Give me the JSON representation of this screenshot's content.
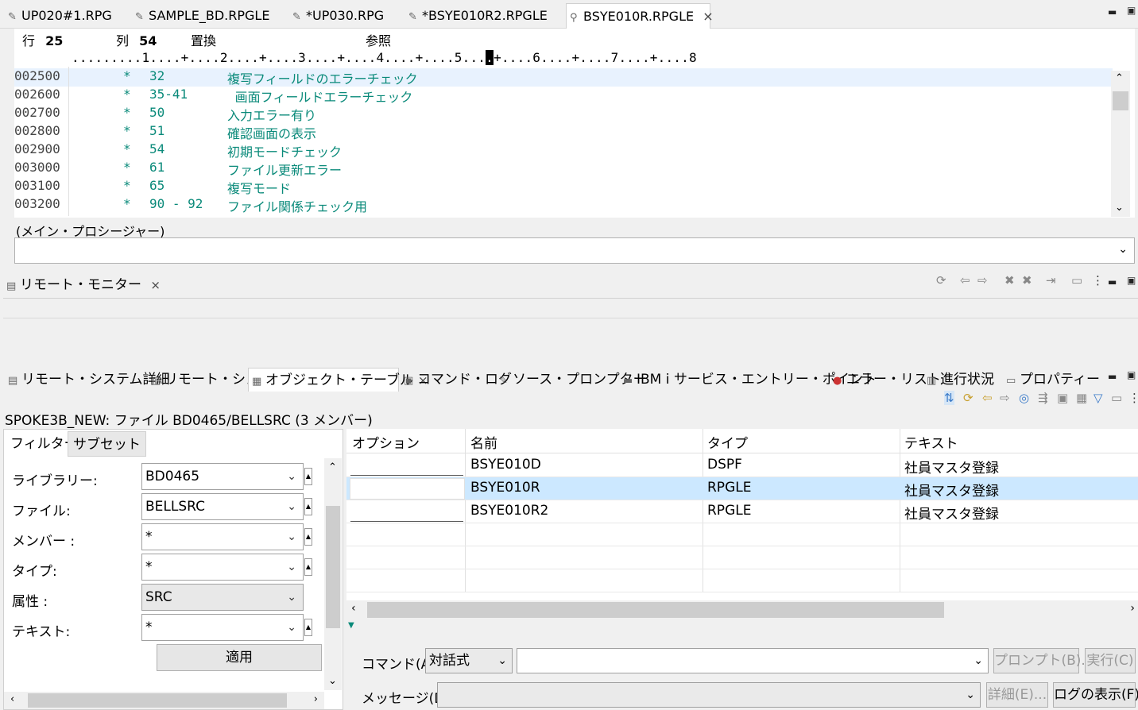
{
  "editor_tabs": [
    {
      "label": "UP020#1.RPG",
      "icon": "pencil-icon"
    },
    {
      "label": "SAMPLE_BD.RPGLE",
      "icon": "pencil-icon"
    },
    {
      "label": "*UP030.RPG",
      "icon": "pencil-icon"
    },
    {
      "label": "*BSYE010R2.RPGLE",
      "icon": "pencil-icon"
    },
    {
      "label": "BSYE010R.RPGLE",
      "icon": "search-icon",
      "close": "×"
    }
  ],
  "editor": {
    "row_label": "行",
    "row_value": "25",
    "col_label": "列",
    "col_value": "54",
    "mode": "置換",
    "view": "参照",
    "ruler_left": ".........1....+....2....+....3....+....4....+....5...",
    "ruler_cursor": ".",
    "ruler_right": "+....6....+....7....+....8",
    "lines": [
      {
        "seq": "002500",
        "star": "*",
        "num": "32",
        "comment": "複写フィールドのエラーチェック"
      },
      {
        "seq": "002600",
        "star": "*",
        "num": "35-41",
        "comment": " 画面フィールドエラーチェック"
      },
      {
        "seq": "002700",
        "star": "*",
        "num": "50",
        "comment": "入力エラー有り"
      },
      {
        "seq": "002800",
        "star": "*",
        "num": "51",
        "comment": "確認画面の表示"
      },
      {
        "seq": "002900",
        "star": "*",
        "num": "54",
        "comment": "初期モードチェック"
      },
      {
        "seq": "003000",
        "star": "*",
        "num": "61",
        "comment": "ファイル更新エラー"
      },
      {
        "seq": "003100",
        "star": "*",
        "num": "65",
        "comment": "複写モード"
      },
      {
        "seq": "003200",
        "star": "*",
        "num": "90 - 92",
        "comment": "ファイル関係チェック用"
      }
    ]
  },
  "procedure": {
    "label": "(メイン・プロシージャー)",
    "value": ""
  },
  "monitor": {
    "tab_label": "リモート・モニター",
    "close": "×"
  },
  "bottom_tabs": [
    {
      "label": "リモート・システム詳細",
      "icon": "system-details-icon"
    },
    {
      "label": "リモート・シェル",
      "icon": "shell-icon"
    },
    {
      "label": "オブジェクト・テーブル",
      "icon": "table-icon",
      "close": "×"
    },
    {
      "label": "コマンド・ログ",
      "icon": "log-icon"
    },
    {
      "label": "ソース・プロンプター",
      "icon": "prompter-icon"
    },
    {
      "label": "IBM i サービス・エントリー・ポイント",
      "icon": "entry-point-icon"
    },
    {
      "label": "エラー・リスト",
      "icon": "error-icon"
    },
    {
      "label": "進行状況",
      "icon": "progress-icon"
    },
    {
      "label": "プロパティー",
      "icon": "properties-icon"
    }
  ],
  "object_table": {
    "title": "SPOKE3B_NEW: ファイル BD0465/BELLSRC (3 メンバー)",
    "filter_tabs": [
      "フィルター",
      "サブセット"
    ],
    "filters": [
      {
        "label": "ライブラリー:",
        "value": "BD0465"
      },
      {
        "label": "ファイル:",
        "value": "BELLSRC"
      },
      {
        "label": "メンバー :",
        "value": "*"
      },
      {
        "label": "タイプ:",
        "value": "*"
      },
      {
        "label": "属性 :",
        "value": "SRC"
      },
      {
        "label": "テキスト:",
        "value": "*"
      }
    ],
    "apply_label": "適用",
    "columns": [
      "オプション",
      "名前",
      "タイプ",
      "テキスト"
    ],
    "rows": [
      {
        "option": "",
        "name": "BSYE010D",
        "type": "DSPF",
        "text": "社員マスタ登録"
      },
      {
        "option": "",
        "name": "BSYE010R",
        "type": "RPGLE",
        "text": "社員マスタ登録"
      },
      {
        "option": "",
        "name": "BSYE010R2",
        "type": "RPGLE",
        "text": "社員マスタ登録"
      }
    ],
    "command_label": "コマンド(A)",
    "command_mode": "対話式",
    "command_value": "",
    "prompt_button": "プロンプト(B)...",
    "run_button": "実行(C)",
    "message_label": "メッセージ(D)",
    "message_value": "",
    "details_button": "詳細(E)...",
    "showlog_button": "ログの表示(F)"
  },
  "colors": {
    "accent": "#0a8a7a",
    "selection": "#cce8ff",
    "line_highlight": "#e8f2fe"
  }
}
